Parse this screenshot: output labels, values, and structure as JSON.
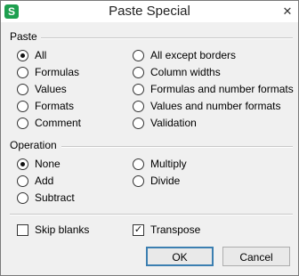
{
  "window": {
    "title": "Paste Special",
    "app_icon_letter": "S",
    "close_glyph": "✕"
  },
  "paste": {
    "label": "Paste",
    "options": [
      "All",
      "Formulas",
      "Values",
      "Formats",
      "Comment",
      "All except borders",
      "Column widths",
      "Formulas and number formats",
      "Values and number formats",
      "Validation"
    ],
    "selected": "All"
  },
  "operation": {
    "label": "Operation",
    "options": [
      "None",
      "Add",
      "Subtract",
      "Multiply",
      "Divide"
    ],
    "selected": "None"
  },
  "checks": {
    "skip_blanks": {
      "label": "Skip blanks",
      "checked": false
    },
    "transpose": {
      "label": "Transpose",
      "checked": true,
      "check_glyph": "✓"
    }
  },
  "buttons": {
    "ok": "OK",
    "cancel": "Cancel"
  },
  "colors": {
    "app_icon": "#1e9f4f",
    "default_button_border": "#3c7fb1"
  }
}
